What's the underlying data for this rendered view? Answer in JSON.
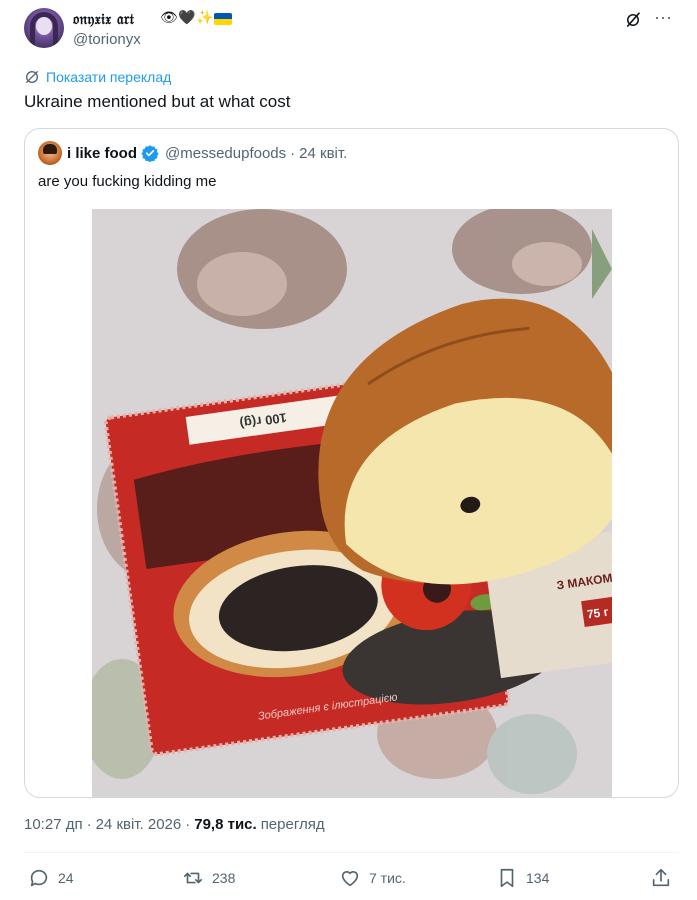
{
  "author": {
    "display_name": "𝔬𝔫𝔶𝔵𝔦𝔵 𝔞𝔯𝔱",
    "emojis": [
      "👁",
      "🖤",
      "✨"
    ],
    "flag_colors": [
      "#0057b7",
      "#ffd700"
    ],
    "handle": "@torionyx"
  },
  "translate_label": "Показати переклад",
  "tweet_text": "Ukraine mentioned but at what cost",
  "quote": {
    "name": "i like food",
    "handle": "@messedupfoods",
    "separator": "·",
    "date": "24 квіт.",
    "text": "are you fucking kidding me",
    "photo_text": {
      "weight_label": "100 г(g)",
      "caption": "Зображення є ілюстрацією",
      "side_label": "З МАКОМ",
      "side_weight": "75 г"
    }
  },
  "meta": {
    "time": "10:27 дп",
    "sep": "·",
    "date": "24 квіт. 2026",
    "views_count": "79,8 тис.",
    "views_label": "перегляд"
  },
  "actions": {
    "replies": "24",
    "reposts": "238",
    "likes": "7 тис.",
    "bookmarks": "134"
  },
  "colors": {
    "accent": "#1d9bf0",
    "secondary_text": "#536471",
    "border": "#cfd9de"
  },
  "icons": [
    "grok-icon",
    "more-icon",
    "translate-icon",
    "verified-badge-icon",
    "reply-icon",
    "repost-icon",
    "like-icon",
    "bookmark-icon",
    "share-icon"
  ]
}
